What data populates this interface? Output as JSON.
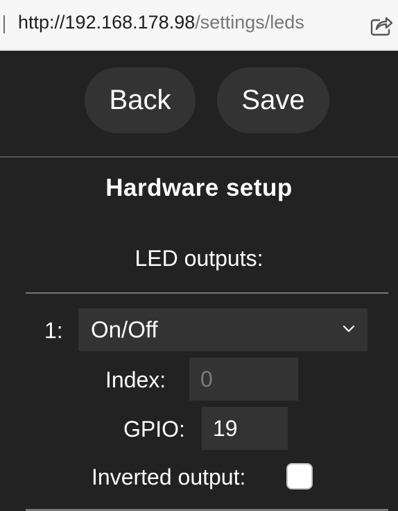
{
  "browser": {
    "url_host": "http://192.168.178.98",
    "url_path": "/settings/leds",
    "share_icon": "share-icon"
  },
  "toolbar": {
    "back_label": "Back",
    "save_label": "Save"
  },
  "page": {
    "title": "Hardware setup",
    "subtitle": "LED outputs:"
  },
  "led_outputs": [
    {
      "number_label": "1:",
      "type_selected": "On/Off",
      "index_label": "Index:",
      "index_placeholder": "0",
      "gpio_label": "GPIO:",
      "gpio_value": "19",
      "inverted_label": "Inverted output:",
      "inverted_checked": false
    }
  ],
  "colors": {
    "page_background": "#222222",
    "control_background": "#333333",
    "text": "#ffffff"
  }
}
